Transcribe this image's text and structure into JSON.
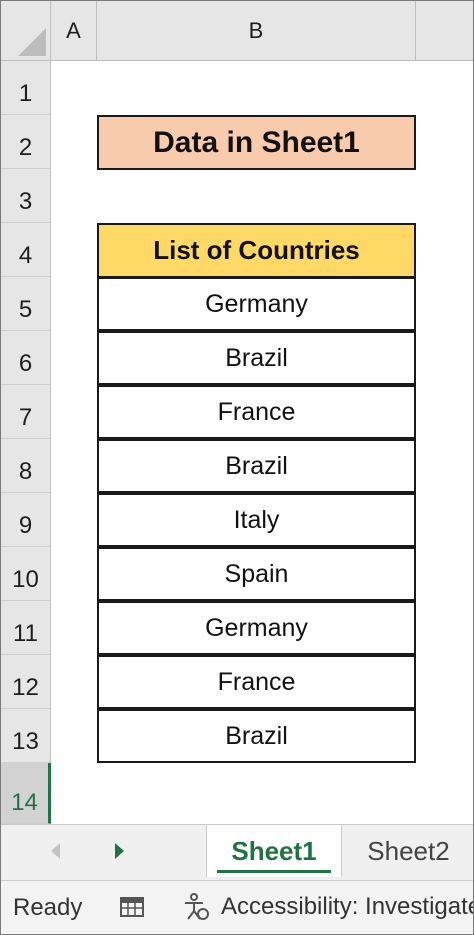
{
  "columns": [
    "A",
    "B"
  ],
  "rows": [
    "1",
    "2",
    "3",
    "4",
    "5",
    "6",
    "7",
    "8",
    "9",
    "10",
    "11",
    "12",
    "13",
    "14"
  ],
  "title_cell": "Data in Sheet1",
  "table": {
    "header": "List of Countries",
    "items": [
      "Germany",
      "Brazil",
      "France",
      "Brazil",
      "Italy",
      "Spain",
      "Germany",
      "France",
      "Brazil"
    ]
  },
  "tabs": {
    "active": "Sheet1",
    "inactive": "Sheet2"
  },
  "status": {
    "ready": "Ready",
    "accessibility": "Accessibility: Investigate"
  },
  "colors": {
    "title_fill": "#f8cbad",
    "header_fill": "#ffd966",
    "accent": "#217346"
  }
}
